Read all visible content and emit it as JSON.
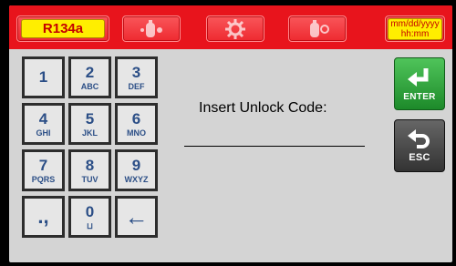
{
  "header": {
    "refrigerant": "R134a",
    "date_format": "mm/dd/yyyy",
    "time_format": "hh:mm",
    "buttons": [
      "recover-tank-icon",
      "settings-gear-icon",
      "vacuum-tank-icon"
    ]
  },
  "keypad": {
    "keys": [
      {
        "num": "1",
        "sub": ""
      },
      {
        "num": "2",
        "sub": "ABC"
      },
      {
        "num": "3",
        "sub": "DEF"
      },
      {
        "num": "4",
        "sub": "GHI"
      },
      {
        "num": "5",
        "sub": "JKL"
      },
      {
        "num": "6",
        "sub": "MNO"
      },
      {
        "num": "7",
        "sub": "PQRS"
      },
      {
        "num": "8",
        "sub": "TUV"
      },
      {
        "num": "9",
        "sub": "WXYZ"
      },
      {
        "num": ".,",
        "sub": ""
      },
      {
        "num": "0",
        "sub": "⊔"
      },
      {
        "num": "←",
        "sub": ""
      }
    ]
  },
  "main": {
    "prompt": "Insert Unlock Code:",
    "code_value": ""
  },
  "side": {
    "enter_label": "ENTER",
    "esc_label": "ESC"
  },
  "colors": {
    "header": "#e8141c",
    "pill": "#ffee00",
    "key_text": "#2b4e86",
    "enter": "#2ea23a"
  }
}
